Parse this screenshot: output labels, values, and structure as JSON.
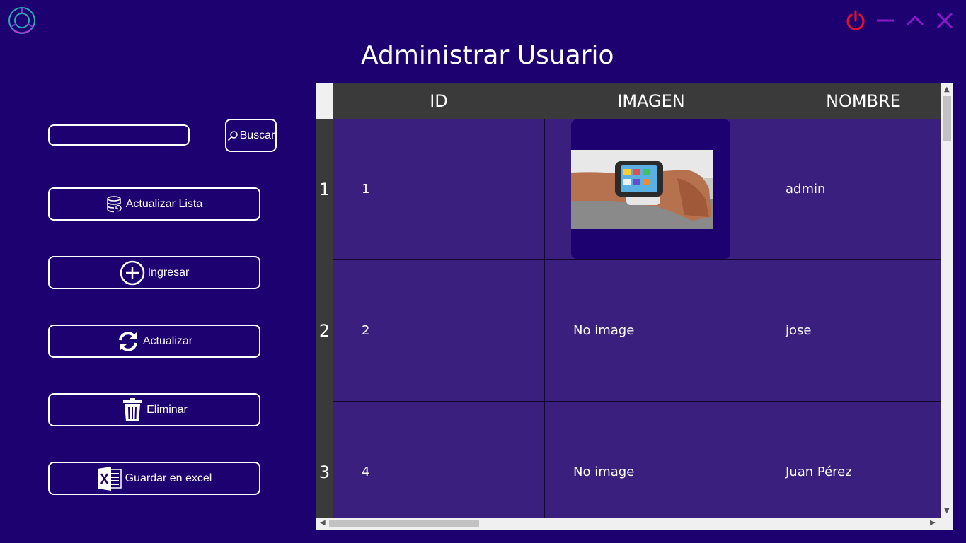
{
  "window": {
    "title": "Administrar Usuario",
    "controls": [
      "power-icon",
      "minimize-icon",
      "maximize-icon",
      "close-icon"
    ],
    "colors": {
      "power": "#e8102a",
      "controls": "#8a1ac9",
      "background": "#1e0170"
    }
  },
  "search": {
    "value": "",
    "placeholder": "",
    "button_label": "Buscar"
  },
  "sidebar": {
    "buttons": [
      {
        "label": "Actualizar Lista",
        "icon": "database-icon"
      },
      {
        "label": "Ingresar",
        "icon": "add-circle-icon"
      },
      {
        "label": "Actualizar",
        "icon": "refresh-icon"
      },
      {
        "label": "Eliminar",
        "icon": "trash-icon"
      },
      {
        "label": "Guardar en  excel",
        "icon": "excel-icon"
      }
    ]
  },
  "table": {
    "columns": [
      "ID",
      "IMAGEN",
      "NOMBRE"
    ],
    "rows": [
      {
        "row_number": "1",
        "id": "1",
        "imagen": "",
        "nombre": "admin"
      },
      {
        "row_number": "2",
        "id": "2",
        "imagen": "No image",
        "nombre": "jose"
      },
      {
        "row_number": "3",
        "id": "4",
        "imagen": "No image",
        "nombre": "Juan Pérez"
      }
    ]
  }
}
